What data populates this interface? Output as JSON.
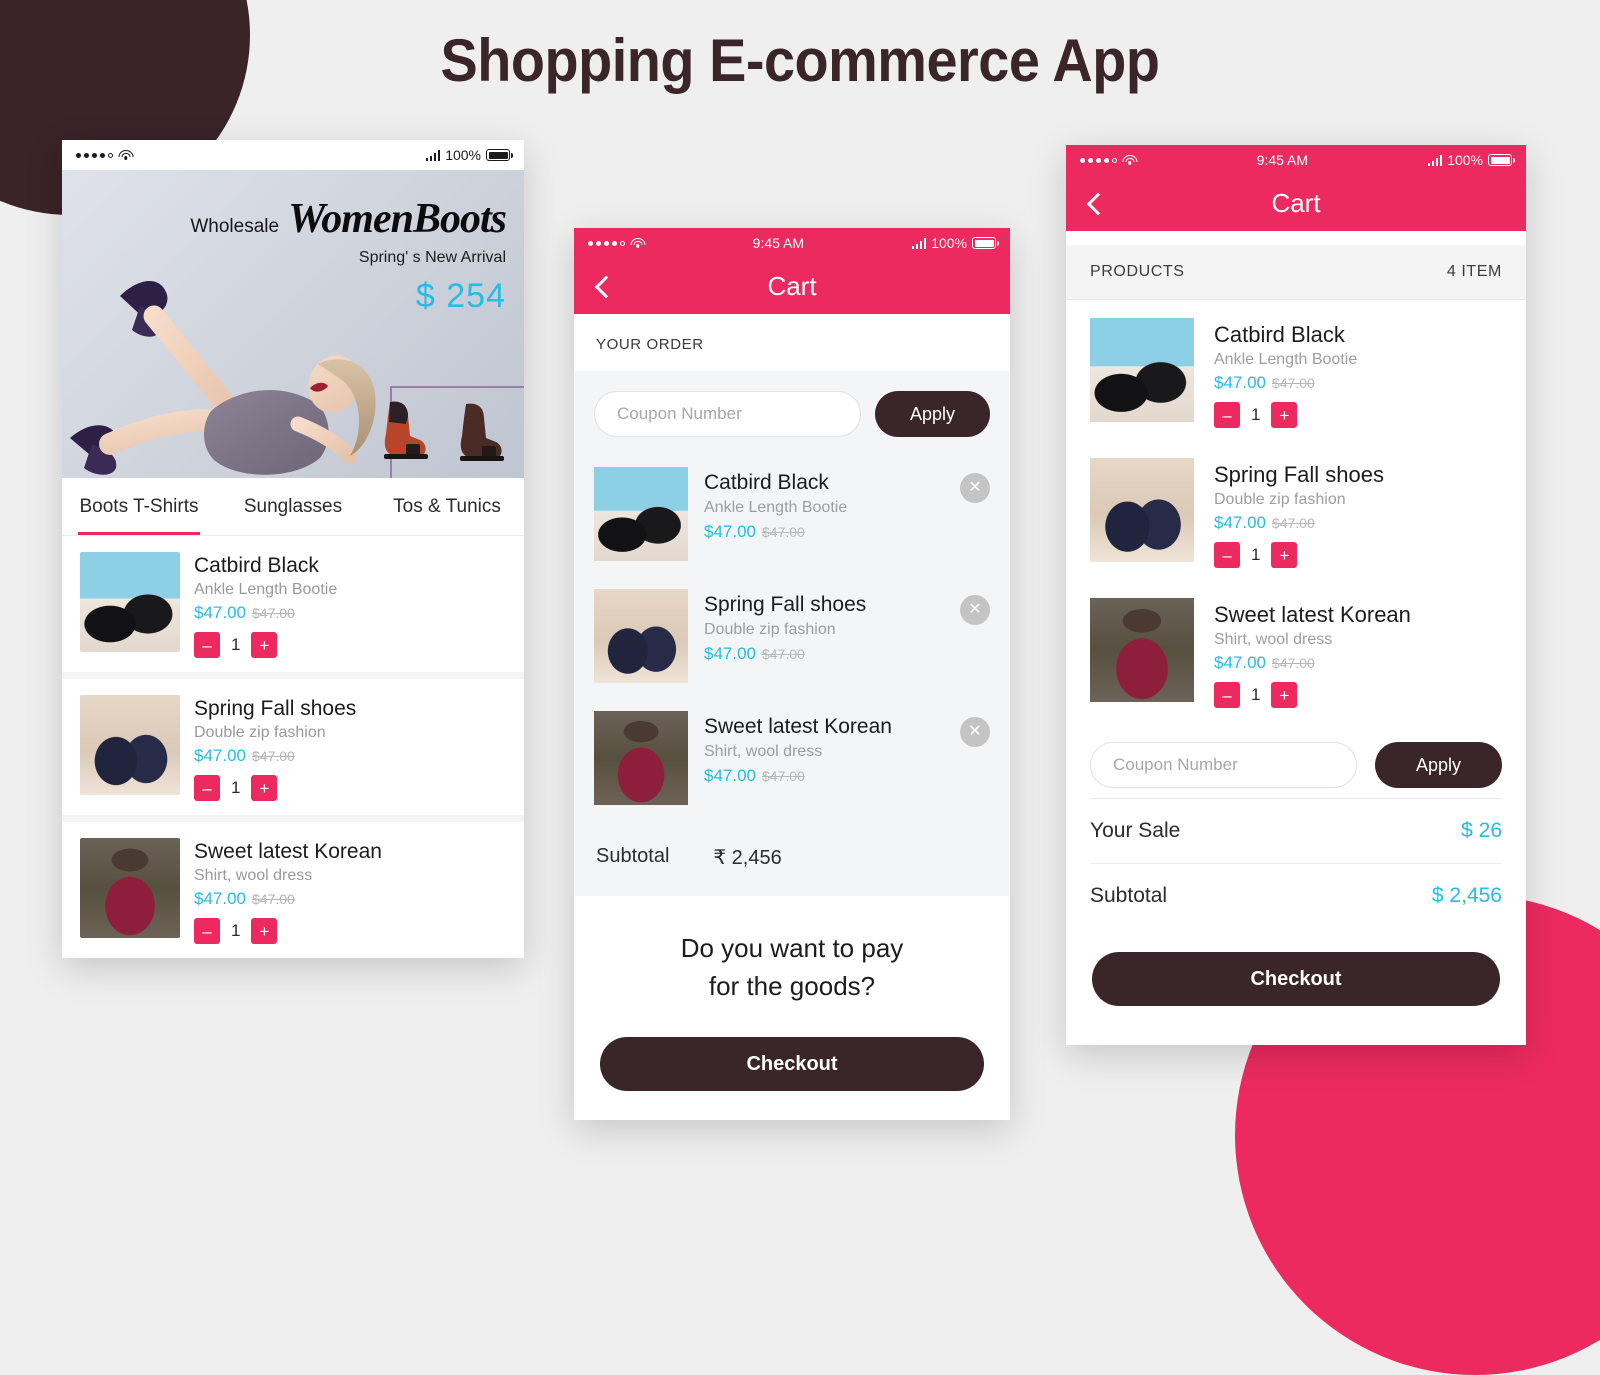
{
  "page": {
    "title": "Shopping E-commerce App",
    "accent_pink": "#ec2a5f",
    "accent_cyan": "#23bde5",
    "dark": "#3a252b"
  },
  "phone_left": {
    "status": {
      "wifi_icon": "wifi-icon",
      "signal_icon": "signal-bars-icon",
      "battery_icon": "battery-icon",
      "battery_label": "100%"
    },
    "hero": {
      "wholesale": "Wholesale",
      "brand": "WomenBoots",
      "subtitle": "Spring' s New Arrival",
      "price": "$ 254"
    },
    "tabs": [
      {
        "label": "Boots T-Shirts",
        "active": true
      },
      {
        "label": "Sunglasses",
        "active": false
      },
      {
        "label": "Tos & Tunics",
        "active": false
      }
    ],
    "products": [
      {
        "title": "Catbird Black",
        "desc": "Ankle Length Bootie",
        "price": "$47.00",
        "old_price": "$47.00",
        "qty": "1",
        "img": "img-boots"
      },
      {
        "title": "Spring Fall shoes",
        "desc": "Double zip fashion",
        "price": "$47.00",
        "old_price": "$47.00",
        "qty": "1",
        "img": "img-spring"
      },
      {
        "title": "Sweet latest Korean",
        "desc": "Shirt, wool dress",
        "price": "$47.00",
        "old_price": "$47.00",
        "qty": "1",
        "img": "img-korean"
      }
    ],
    "stepper": {
      "minus": "–",
      "plus": "+"
    }
  },
  "phone_mid": {
    "status": {
      "time": "9:45 AM",
      "battery_label": "100%"
    },
    "header": {
      "title": "Cart",
      "back_icon": "back-chevron-icon"
    },
    "section_label": "YOUR ORDER",
    "coupon": {
      "placeholder": "Coupon Number",
      "value": "",
      "apply_label": "Apply"
    },
    "items": [
      {
        "title": "Catbird Black",
        "desc": "Ankle Length Bootie",
        "price": "$47.00",
        "old_price": "$47.00",
        "remove_icon": "close-icon",
        "img": "img-boots"
      },
      {
        "title": "Spring Fall shoes",
        "desc": "Double zip fashion",
        "price": "$47.00",
        "old_price": "$47.00",
        "remove_icon": "close-icon",
        "img": "img-spring"
      },
      {
        "title": "Sweet latest Korean",
        "desc": "Shirt, wool dress",
        "price": "$47.00",
        "old_price": "$47.00",
        "remove_icon": "close-icon",
        "img": "img-korean"
      }
    ],
    "subtotal_label": "Subtotal",
    "subtotal_value": "₹ 2,456",
    "pay_line1": "Do you want to pay",
    "pay_line2": "for the goods?",
    "checkout_label": "Checkout"
  },
  "phone_right": {
    "status": {
      "time": "9:45 AM",
      "battery_label": "100%"
    },
    "header": {
      "title": "Cart",
      "back_icon": "back-chevron-icon"
    },
    "products_label": "PRODUCTS",
    "item_count": "4 ITEM",
    "products": [
      {
        "title": "Catbird Black",
        "desc": "Ankle Length Bootie",
        "price": "$47.00",
        "old_price": "$47.00",
        "qty": "1",
        "img": "img-boots"
      },
      {
        "title": "Spring Fall shoes",
        "desc": "Double zip fashion",
        "price": "$47.00",
        "old_price": "$47.00",
        "qty": "1",
        "img": "img-spring"
      },
      {
        "title": "Sweet latest Korean",
        "desc": "Shirt, wool dress",
        "price": "$47.00",
        "old_price": "$47.00",
        "qty": "1",
        "img": "img-korean"
      }
    ],
    "coupon": {
      "placeholder": "Coupon Number",
      "value": "",
      "apply_label": "Apply"
    },
    "totals": [
      {
        "label": "Your Sale",
        "value": "$ 26"
      },
      {
        "label": "Subtotal",
        "value": "$ 2,456"
      }
    ],
    "checkout_label": "Checkout",
    "stepper": {
      "minus": "–",
      "plus": "+"
    }
  }
}
